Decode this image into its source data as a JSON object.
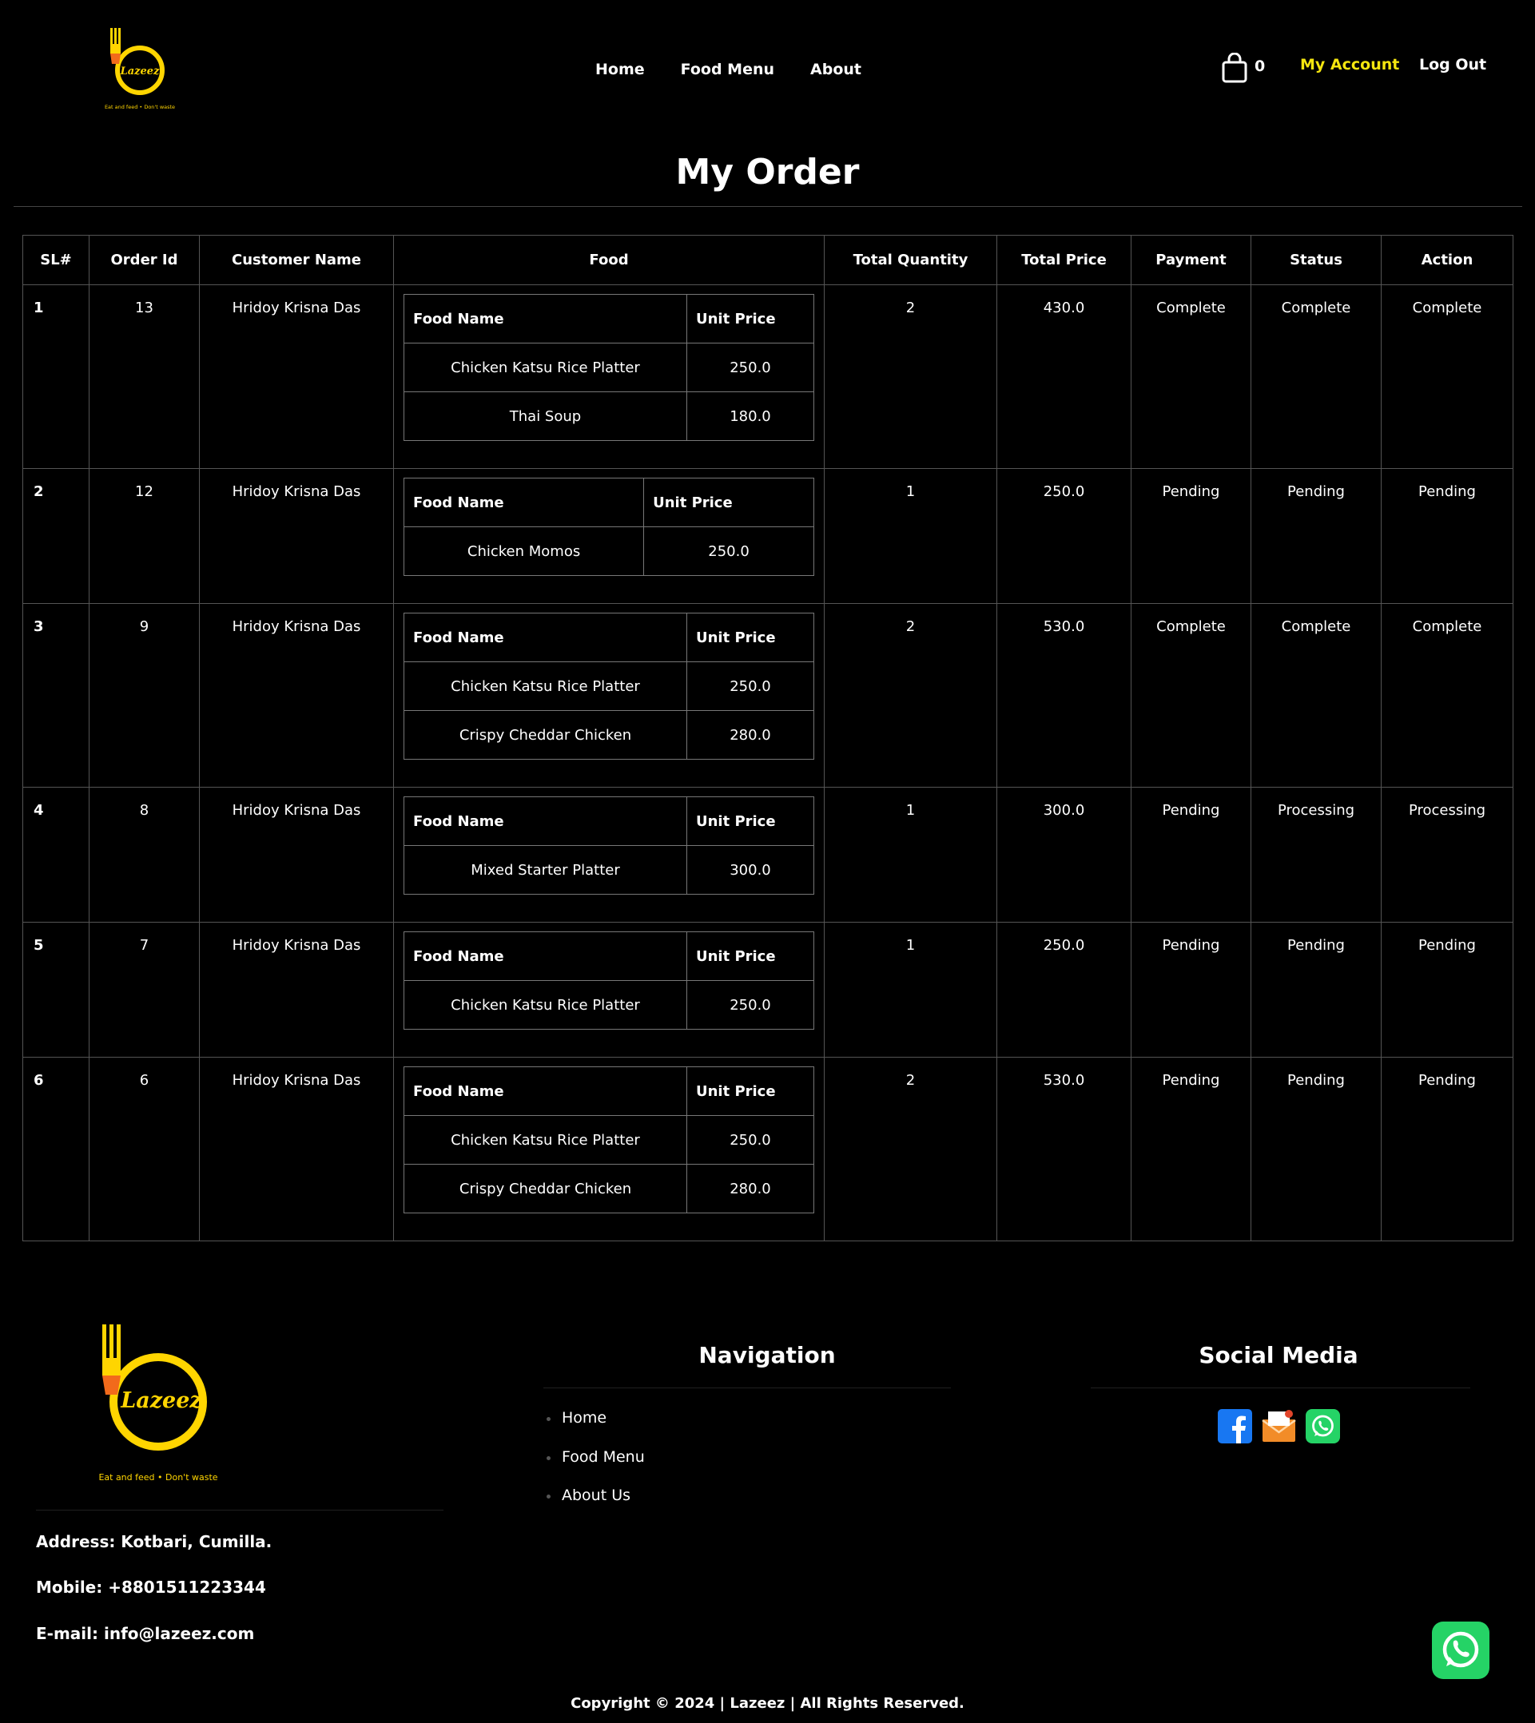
{
  "header": {
    "logo_word": "Lazeez",
    "logo_tagline": "Eat and feed • Don't waste",
    "nav": [
      "Home",
      "Food Menu",
      "About"
    ],
    "cart_count": "0",
    "my_account": "My Account",
    "logout": "Log Out"
  },
  "page_title": "My Order",
  "orders_table": {
    "headers": [
      "SL#",
      "Order Id",
      "Customer Name",
      "Food",
      "Total Quantity",
      "Total Price",
      "Payment",
      "Status",
      "Action"
    ],
    "food_headers": [
      "Food Name",
      "Unit Price"
    ],
    "rows": [
      {
        "sl": "1",
        "order_id": "13",
        "customer": "Hridoy Krisna Das",
        "foods": [
          {
            "name": "Chicken Katsu Rice Platter",
            "price": "250.0"
          },
          {
            "name": "Thai Soup",
            "price": "180.0"
          }
        ],
        "qty": "2",
        "total": "430.0",
        "payment": "Complete",
        "status": "Complete",
        "action": "Complete"
      },
      {
        "sl": "2",
        "order_id": "12",
        "customer": "Hridoy Krisna Das",
        "foods": [
          {
            "name": "Chicken Momos",
            "price": "250.0"
          }
        ],
        "qty": "1",
        "total": "250.0",
        "payment": "Pending",
        "status": "Pending",
        "action": "Pending"
      },
      {
        "sl": "3",
        "order_id": "9",
        "customer": "Hridoy Krisna Das",
        "foods": [
          {
            "name": "Chicken Katsu Rice Platter",
            "price": "250.0"
          },
          {
            "name": "Crispy Cheddar Chicken",
            "price": "280.0"
          }
        ],
        "qty": "2",
        "total": "530.0",
        "payment": "Complete",
        "status": "Complete",
        "action": "Complete"
      },
      {
        "sl": "4",
        "order_id": "8",
        "customer": "Hridoy Krisna Das",
        "foods": [
          {
            "name": "Mixed Starter Platter",
            "price": "300.0"
          }
        ],
        "qty": "1",
        "total": "300.0",
        "payment": "Pending",
        "status": "Processing",
        "action": "Processing"
      },
      {
        "sl": "5",
        "order_id": "7",
        "customer": "Hridoy Krisna Das",
        "foods": [
          {
            "name": "Chicken Katsu Rice Platter",
            "price": "250.0"
          }
        ],
        "qty": "1",
        "total": "250.0",
        "payment": "Pending",
        "status": "Pending",
        "action": "Pending"
      },
      {
        "sl": "6",
        "order_id": "6",
        "customer": "Hridoy Krisna Das",
        "foods": [
          {
            "name": "Chicken Katsu Rice Platter",
            "price": "250.0"
          },
          {
            "name": "Crispy Cheddar Chicken",
            "price": "280.0"
          }
        ],
        "qty": "2",
        "total": "530.0",
        "payment": "Pending",
        "status": "Pending",
        "action": "Pending"
      }
    ]
  },
  "footer": {
    "address": "Address: Kotbari, Cumilla.",
    "mobile": "Mobile: +8801511223344",
    "email": "E-mail: info@lazeez.com",
    "nav_heading": "Navigation",
    "nav_links": [
      "Home",
      "Food Menu",
      "About Us"
    ],
    "social_heading": "Social Media",
    "social_icons": [
      "facebook-icon",
      "email-icon",
      "whatsapp-icon"
    ],
    "copyright": "Copyright © 2024 | Lazeez | All Rights Reserved."
  },
  "colors": {
    "background": "#000000",
    "accent_yellow": "#f5e60f",
    "logo_yellow": "#ffd500",
    "logo_orange": "#f26a1b",
    "facebook_blue": "#1877f2",
    "whatsapp_green": "#25d366"
  }
}
